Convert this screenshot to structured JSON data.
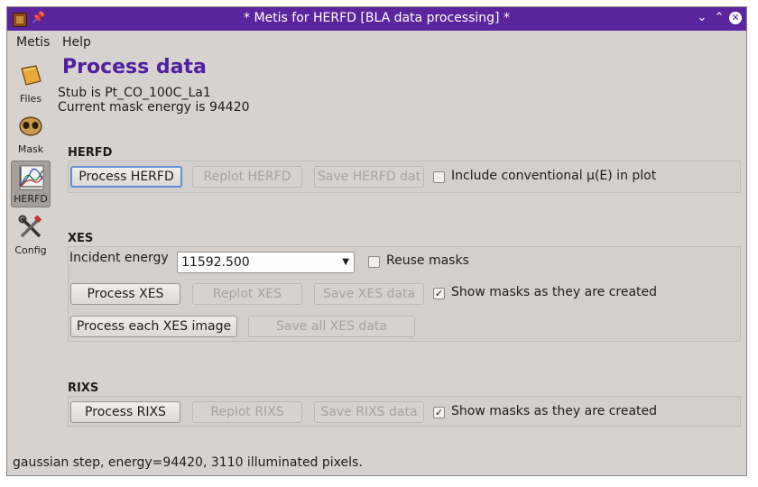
{
  "window": {
    "title": "* Metis for HERFD [BLA data processing] *"
  },
  "menu": {
    "items": [
      "Metis",
      "Help"
    ]
  },
  "sidebar": {
    "items": [
      {
        "label": "Files",
        "icon": "folder-icon"
      },
      {
        "label": "Mask",
        "icon": "mask-icon"
      },
      {
        "label": "HERFD",
        "icon": "chart-icon",
        "active": true
      },
      {
        "label": "Config",
        "icon": "tools-icon"
      }
    ]
  },
  "page": {
    "heading": "Process data",
    "stub_line": "Stub is Pt_CO_100C_La1",
    "mask_energy_line": "Current mask energy is 94420"
  },
  "herfd": {
    "section_title": "HERFD",
    "process_label": "Process HERFD",
    "replot_label": "Replot HERFD",
    "save_label": "Save HERFD dat",
    "include_label": "Include conventional μ(E) in plot",
    "include_checked": false
  },
  "xes": {
    "section_title": "XES",
    "incident_label": "Incident energy",
    "incident_value": "11592.500",
    "reuse_label": "Reuse masks",
    "reuse_checked": false,
    "process_label": "Process XES",
    "replot_label": "Replot XES",
    "save_label": "Save XES data",
    "show_masks_label": "Show masks as they are created",
    "show_masks_checked": true,
    "process_each_label": "Process each XES image",
    "save_all_label": "Save all XES data"
  },
  "rixs": {
    "section_title": "RIXS",
    "process_label": "Process RIXS",
    "replot_label": "Replot RIXS",
    "save_label": "Save RIXS data",
    "show_masks_label": "Show masks as they are created",
    "show_masks_checked": true
  },
  "status": {
    "text": "gaussian step, energy=94420, 3110 illuminated pixels."
  }
}
